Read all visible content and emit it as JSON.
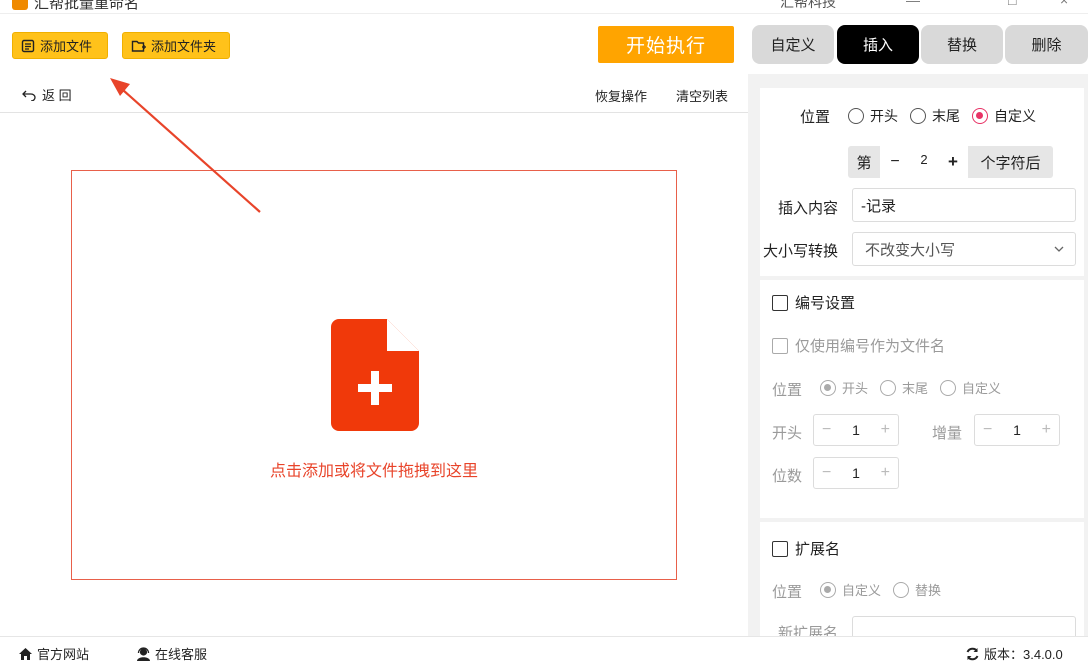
{
  "window": {
    "title": "汇帮批量重命名",
    "right_text": "汇帮科技"
  },
  "toolbar": {
    "add_file": "添加文件",
    "add_folder": "添加文件夹",
    "start": "开始执行",
    "accent": "#ffc21a",
    "start_color": "#ffa400"
  },
  "modes": {
    "tabs": [
      "自定义",
      "插入",
      "替换",
      "删除"
    ],
    "active": "插入"
  },
  "subbar": {
    "back": "返 回",
    "restore": "恢复操作",
    "clear": "清空列表"
  },
  "dropzone": {
    "text": "点击添加或将文件拖拽到这里",
    "icon_color": "#f0390a"
  },
  "insert": {
    "position_label": "位置",
    "position_options": [
      "开头",
      "末尾",
      "自定义"
    ],
    "position_selected": "自定义",
    "nth_prefix": "第",
    "nth_value": "2",
    "nth_suffix": "个字符后",
    "minus": "−",
    "plus": "+",
    "content_label": "插入内容",
    "content_value": "-记录",
    "case_label": "大小写转换",
    "case_value": "不改变大小写"
  },
  "numbering": {
    "title": "编号设置",
    "only_number": "仅使用编号作为文件名",
    "position_label": "位置",
    "position_options": [
      "开头",
      "末尾",
      "自定义"
    ],
    "position_selected": "开头",
    "start_label": "开头",
    "start_value": "1",
    "increment_label": "增量",
    "increment_value": "1",
    "digits_label": "位数",
    "digits_value": "1",
    "minus": "−",
    "plus": "+"
  },
  "extension": {
    "title": "扩展名",
    "position_label": "位置",
    "options": [
      "自定义",
      "替换"
    ],
    "selected": "自定义",
    "new_ext_label": "新扩展名"
  },
  "footer": {
    "website": "官方网站",
    "support": "在线客服",
    "version": "版本：3.4.0.0"
  }
}
